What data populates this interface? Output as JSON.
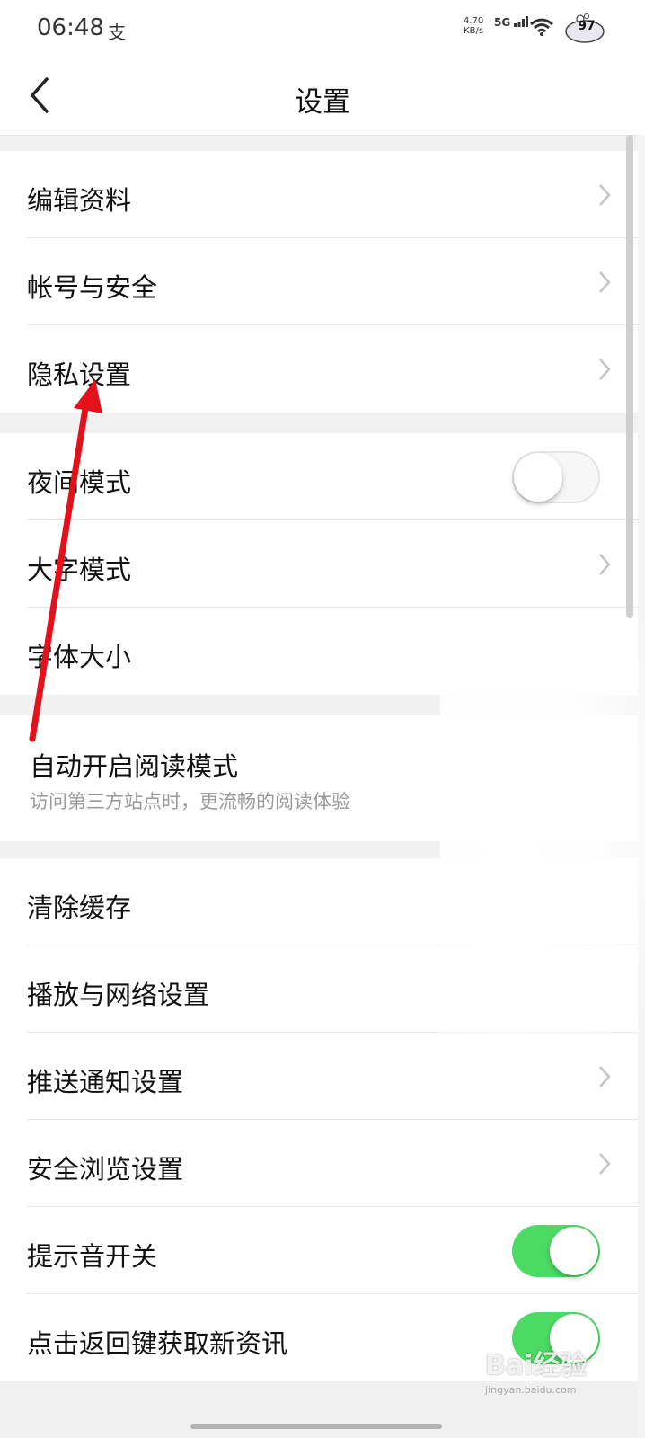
{
  "status_bar": {
    "time": "06:48",
    "app_indicator": "支",
    "net_speed_value": "4.70",
    "net_speed_unit": "KB/s",
    "network": "5G",
    "battery": "97"
  },
  "header": {
    "title": "设置"
  },
  "groups": [
    {
      "items": [
        {
          "label": "编辑资料",
          "control": "chevron"
        },
        {
          "label": "帐号与安全",
          "control": "chevron"
        },
        {
          "label": "隐私设置",
          "control": "chevron"
        }
      ]
    },
    {
      "items": [
        {
          "label": "夜间模式",
          "control": "toggle",
          "state": "off"
        },
        {
          "label": "大字模式",
          "control": "chevron"
        },
        {
          "label": "字体大小",
          "control": "none"
        }
      ]
    },
    {
      "items": [
        {
          "label": "自动开启阅读模式",
          "sublabel": "访问第三方站点时，更流畅的阅读体验",
          "control": "none"
        }
      ]
    },
    {
      "items": [
        {
          "label": "清除缓存",
          "control": "none"
        },
        {
          "label": "播放与网络设置",
          "control": "none"
        },
        {
          "label": "推送通知设置",
          "control": "chevron"
        },
        {
          "label": "安全浏览设置",
          "control": "chevron"
        },
        {
          "label": "提示音开关",
          "control": "toggle",
          "state": "on"
        },
        {
          "label": "点击返回键获取新资讯",
          "control": "toggle",
          "state": "on"
        }
      ]
    }
  ],
  "watermark": {
    "text": "Bai经验",
    "url": "jingyan.baidu.com"
  },
  "colors": {
    "toggle_on": "#4cd964",
    "arrow": "#e2111a"
  }
}
